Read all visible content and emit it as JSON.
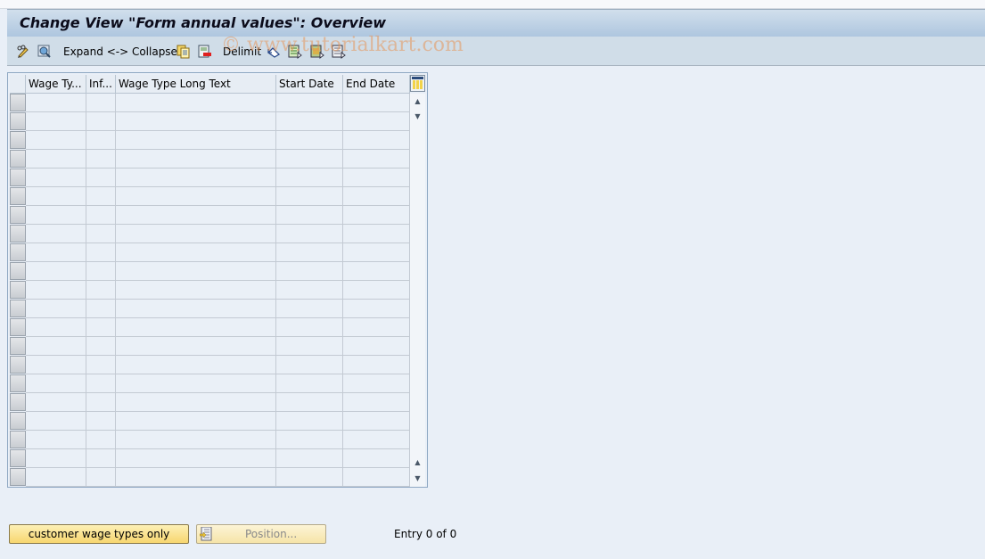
{
  "window": {
    "title": "Change View \"Form annual values\": Overview"
  },
  "toolbar": {
    "items": [
      {
        "type": "icon",
        "name": "change-display-icon"
      },
      {
        "type": "icon",
        "name": "find-icon"
      },
      {
        "type": "text",
        "label": "Expand <-> Collapse"
      },
      {
        "type": "icon",
        "name": "copy-as-icon"
      },
      {
        "type": "icon",
        "name": "delete-icon"
      },
      {
        "type": "text",
        "label": "Delimit"
      },
      {
        "type": "icon",
        "name": "undo-change-icon"
      },
      {
        "type": "icon",
        "name": "select-all-icon"
      },
      {
        "type": "icon",
        "name": "select-block-icon"
      },
      {
        "type": "icon",
        "name": "deselect-all-icon"
      }
    ],
    "expand_collapse_label": "Expand <-> Collapse",
    "delimit_label": "Delimit"
  },
  "watermark": "© www.tutorialkart.com",
  "table": {
    "columns": [
      {
        "label": "Wage Ty..."
      },
      {
        "label": "Inf..."
      },
      {
        "label": "Wage Type Long Text"
      },
      {
        "label": "Start Date"
      },
      {
        "label": "End Date"
      }
    ],
    "row_count_visible": 21,
    "rows": []
  },
  "footer": {
    "customer_button_label": "customer wage types only",
    "position_button_label": "Position...",
    "entry_text": "Entry 0 of 0"
  }
}
